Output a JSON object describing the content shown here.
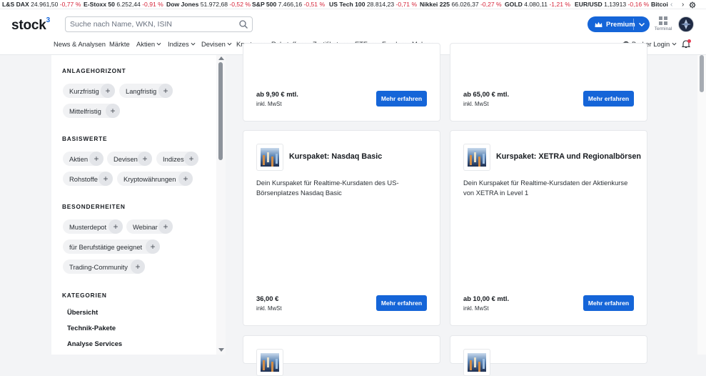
{
  "ticker": [
    {
      "name": "L&S DAX",
      "value": "24.961,50",
      "change": "-0,77 %"
    },
    {
      "name": "E-Stoxx 50",
      "value": "6.252,44",
      "change": "-0,91 %"
    },
    {
      "name": "Dow Jones",
      "value": "51.972,68",
      "change": "-0,52 %"
    },
    {
      "name": "S&P 500",
      "value": "7.466,16",
      "change": "-0,51 %"
    },
    {
      "name": "US Tech 100",
      "value": "28.814,23",
      "change": "-0,71 %"
    },
    {
      "name": "Nikkei 225",
      "value": "66.026,37",
      "change": "-0,27 %"
    },
    {
      "name": "GOLD",
      "value": "4.080,11",
      "change": "-1,21 %"
    },
    {
      "name": "EUR/USD",
      "value": "1,13913",
      "change": "-0,16 %"
    },
    {
      "name": "Bitcoi",
      "value": "",
      "change": ""
    }
  ],
  "header": {
    "logo_text": "stock",
    "logo_sup": "3",
    "search_placeholder": "Suche nach Name, WKN, ISIN",
    "premium_label": "Premium",
    "terminal_label": "Terminal",
    "broker_label": "Broker Login"
  },
  "nav": [
    "News & Analysen",
    "Märkte",
    "Aktien",
    "Indizes",
    "Devisen",
    "Kryptos",
    "Rohstoffe",
    "Zertifikate",
    "ETFs",
    "Fonds",
    "Mehr"
  ],
  "sidebar": {
    "sections": [
      {
        "title": "ANLAGEHORIZONT",
        "chips": [
          "Kurzfristig",
          "Langfristig",
          "Mittelfristig"
        ]
      },
      {
        "title": "BASISWERTE",
        "chips": [
          "Aktien",
          "Devisen",
          "Indizes",
          "Rohstoffe",
          "Kryptowährungen"
        ]
      },
      {
        "title": "BESONDERHEITEN",
        "chips": [
          "Musterdepot",
          "Webinar",
          "für Berufstätige geeignet",
          "Trading-Community"
        ]
      },
      {
        "title": "KATEGORIEN",
        "links": [
          "Übersicht",
          "Technik-Pakete",
          "Analyse Services"
        ]
      }
    ]
  },
  "cards": [
    {
      "price": "ab 9,90 € mtl.",
      "tax": "inkl. MwSt",
      "button": "Mehr erfahren"
    },
    {
      "price": "ab 65,00 € mtl.",
      "tax": "inkl. MwSt",
      "button": "Mehr erfahren"
    },
    {
      "title": "Kurspaket: Nasdaq Basic",
      "description": "Dein Kurspaket für Realtime-Kursdaten des US-Börsenplatzes Nasdaq Basic",
      "price": "36,00 €",
      "tax": "inkl. MwSt",
      "button": "Mehr erfahren"
    },
    {
      "title": "Kurspaket: XETRA und Regionalbörsen",
      "description": "Dein Kurspaket für Realtime-Kursdaten der Aktienkurse von XETRA in Level 1",
      "price": "ab 10,00 € mtl.",
      "tax": "inkl. MwSt",
      "button": "Mehr erfahren"
    }
  ],
  "colors": {
    "accent": "#1565d8",
    "negative": "#d6263b",
    "chip_bg": "#f1f2f4"
  }
}
